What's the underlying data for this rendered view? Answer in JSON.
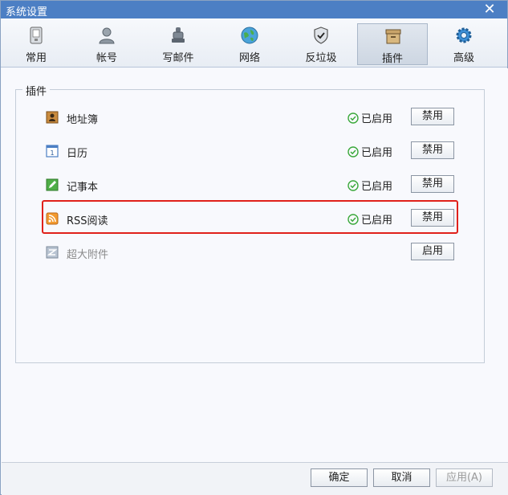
{
  "window": {
    "title": "系统设置",
    "close_label": "✕"
  },
  "toolbar": {
    "tabs": [
      {
        "label": "常用",
        "icon": "phone-icon"
      },
      {
        "label": "帐号",
        "icon": "user-icon"
      },
      {
        "label": "写邮件",
        "icon": "ink-stamp-icon"
      },
      {
        "label": "网络",
        "icon": "globe-icon"
      },
      {
        "label": "反垃圾",
        "icon": "shield-icon"
      },
      {
        "label": "插件",
        "icon": "box-icon",
        "active": true
      },
      {
        "label": "高级",
        "icon": "gear-icon"
      }
    ]
  },
  "plugins": {
    "group_title": "插件",
    "items": [
      {
        "name": "地址簿",
        "icon": "address-book-icon",
        "status": "已启用",
        "action": "禁用",
        "enabled": true
      },
      {
        "name": "日历",
        "icon": "calendar-icon",
        "status": "已启用",
        "action": "禁用",
        "enabled": true
      },
      {
        "name": "记事本",
        "icon": "notepad-icon",
        "status": "已启用",
        "action": "禁用",
        "enabled": true
      },
      {
        "name": "RSS阅读",
        "icon": "rss-icon",
        "status": "已启用",
        "action": "禁用",
        "enabled": true,
        "highlighted": true
      },
      {
        "name": "超大附件",
        "icon": "large-attachment-icon",
        "status": "",
        "action": "启用",
        "enabled": false
      }
    ]
  },
  "footer": {
    "ok_label": "确定",
    "cancel_label": "取消",
    "apply_label": "应用(A)"
  },
  "colors": {
    "titlebar": "#4c7fc4",
    "highlight": "#e0211b",
    "status_check": "#3aa83a"
  }
}
